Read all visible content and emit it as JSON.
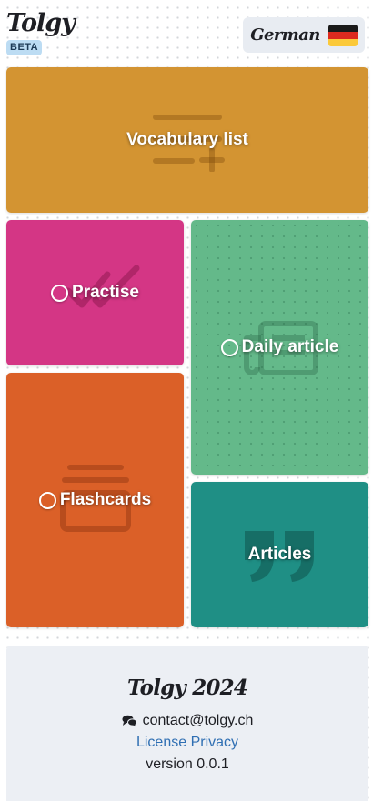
{
  "header": {
    "logo": "Tolgy",
    "badge": "BETA",
    "language_label": "German",
    "language_flag": "german-flag-icon"
  },
  "tiles": {
    "vocabulary": {
      "label": "Vocabulary list",
      "color": "#d39432",
      "icon": "list-add-icon"
    },
    "practise": {
      "label": "Practise",
      "color": "#d43685",
      "icon": "double-check-icon"
    },
    "daily_article": {
      "label": "Daily article",
      "color": "#64b98a",
      "icon": "newspaper-icon"
    },
    "flashcards": {
      "label": "Flashcards",
      "color": "#db6028",
      "icon": "card-stack-icon"
    },
    "articles": {
      "label": "Articles",
      "color": "#1f8f85",
      "icon": "quote-icon"
    }
  },
  "footer": {
    "title": "Tolgy 2024",
    "contact_icon": "comments-icon",
    "email": "contact@tolgy.ch",
    "license_link": "License",
    "privacy_link": "Privacy",
    "version": "version 0.0.1"
  }
}
